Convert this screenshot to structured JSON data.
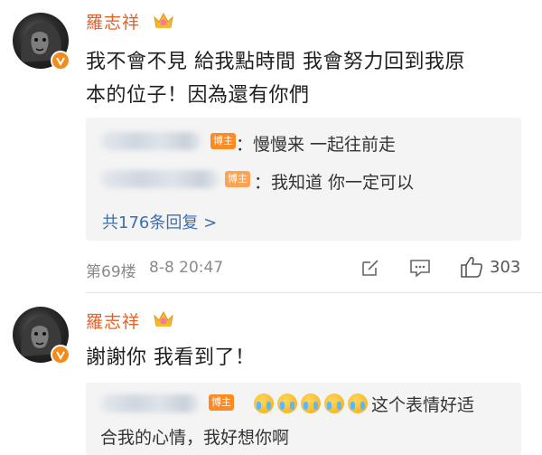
{
  "comments": [
    {
      "username": "羅志祥",
      "avatar_icon": "lion-avatar-icon",
      "verified_icon": "verified-v-icon",
      "crown_icon": "crown-icon",
      "text_line1": "我不會不見 給我點時間 我會努力回到我原",
      "text_line2": "本的位子！因為還有你們",
      "replies": [
        {
          "tag": "博主",
          "text": "：慢慢来 一起往前走"
        },
        {
          "tag": "博主",
          "text": "：我知道 你一定可以"
        }
      ],
      "more_replies": "共176条回复 >",
      "floor": "第69楼",
      "time": "8-8 20:47",
      "actions": {
        "edit_icon": "edit-icon",
        "comment_icon": "comment-icon",
        "like_icon": "thumbs-up-icon",
        "like_count": "303"
      }
    },
    {
      "username": "羅志祥",
      "avatar_icon": "lion-avatar-icon",
      "verified_icon": "verified-v-icon",
      "crown_icon": "crown-icon",
      "text_line1": "謝謝你 我看到了！",
      "reply_tag": "博主",
      "reply_emoji_icon": "crying-face-icon",
      "reply_text_line1": "这个表情好适",
      "reply_text_line2": "合我的心情，我好想你啊"
    }
  ],
  "colors": {
    "username": "#e5622a",
    "blogger_tag": "#ff8a1f",
    "link": "#3b6fb3",
    "reply_bg": "#f4f4f4"
  }
}
